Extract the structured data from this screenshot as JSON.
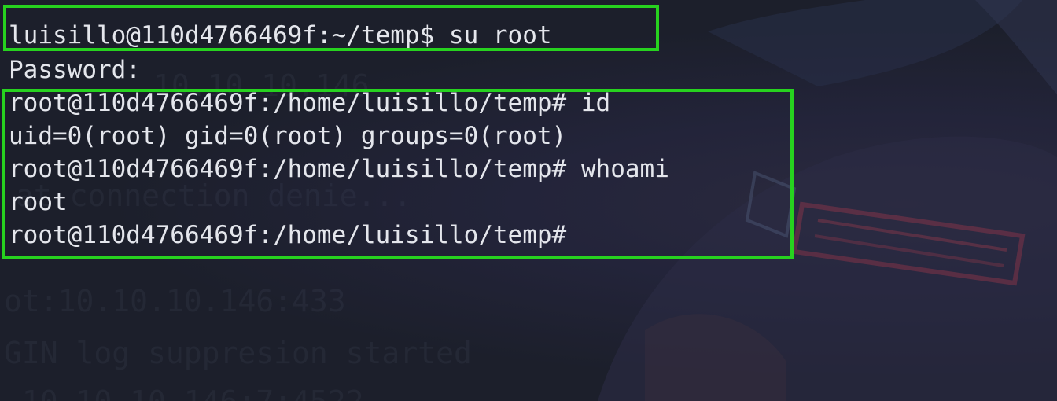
{
  "terminal": {
    "lines": [
      "luisillo@110d4766469f:~/temp$ su root",
      "Password:",
      "root@110d4766469f:/home/luisillo/temp# id",
      "uid=0(root) gid=0(root) groups=0(root)",
      "root@110d4766469f:/home/luisillo/temp# whoami",
      "root",
      "root@110d4766469f:/home/luisillo/temp#"
    ]
  },
  "background_text": [
    "10.10.10.146",
    "at connection denie...",
    "ot:10.10.10.146:433",
    "GIN log suppresion started",
    ".10.10.10.146:7:4522"
  ],
  "colors": {
    "background": "#1c1f2b",
    "text": "#e4e6ec",
    "highlight": "#27d21f"
  }
}
